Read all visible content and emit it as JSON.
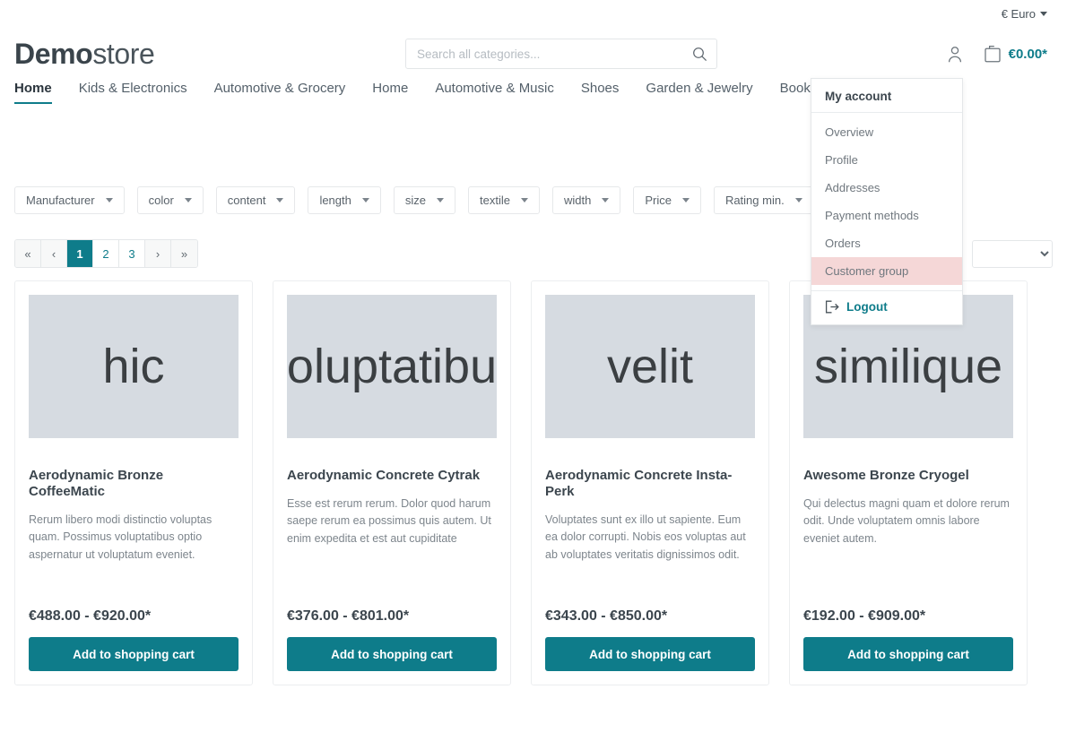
{
  "utility": {
    "currency_label": "€ Euro",
    "caret_icon": "caret-down-icon"
  },
  "header": {
    "logo_bold": "Demo",
    "logo_light": "store",
    "search": {
      "placeholder": "Search all categories...",
      "value": "",
      "icon": "search-icon"
    },
    "account_icon": "user-icon",
    "cart_icon": "shopping-bag-icon",
    "cart_amount": "€0.00*"
  },
  "nav": {
    "items": [
      {
        "label": "Home",
        "active": true
      },
      {
        "label": "Kids & Electronics",
        "active": false
      },
      {
        "label": "Automotive & Grocery",
        "active": false
      },
      {
        "label": "Home",
        "active": false
      },
      {
        "label": "Automotive & Music",
        "active": false
      },
      {
        "label": "Shoes",
        "active": false
      },
      {
        "label": "Garden & Jewelry",
        "active": false
      },
      {
        "label": "Books, Home",
        "active": false
      }
    ]
  },
  "filters": [
    {
      "label": "Manufacturer"
    },
    {
      "label": "color"
    },
    {
      "label": "content"
    },
    {
      "label": "length"
    },
    {
      "label": "size"
    },
    {
      "label": "textile"
    },
    {
      "label": "width"
    },
    {
      "label": "Price"
    },
    {
      "label": "Rating min."
    }
  ],
  "listing": {
    "pagination": [
      {
        "label": "«",
        "type": "arrow",
        "name": "first-page"
      },
      {
        "label": "‹",
        "type": "arrow",
        "name": "prev-page"
      },
      {
        "label": "1",
        "type": "active",
        "name": "page-1"
      },
      {
        "label": "2",
        "type": "page",
        "name": "page-2"
      },
      {
        "label": "3",
        "type": "page",
        "name": "page-3"
      },
      {
        "label": "›",
        "type": "arrow",
        "name": "next-page"
      },
      {
        "label": "»",
        "type": "arrow",
        "name": "last-page"
      }
    ],
    "sorting": {
      "selected": "",
      "options": [
        ""
      ]
    }
  },
  "products": [
    {
      "image_text": "hic",
      "title": "Aerodynamic Bronze CoffeeMatic",
      "description": "Rerum libero modi distinctio voluptas quam. Possimus voluptatibus optio aspernatur ut voluptatum eveniet.",
      "price": "€488.00 - €920.00*",
      "button": "Add to shopping cart"
    },
    {
      "image_text": "voluptatibus",
      "title": "Aerodynamic Concrete Cytrak",
      "description": "Esse est rerum rerum. Dolor quod harum saepe rerum ea possimus quis autem. Ut enim expedita et est aut cupiditate",
      "price": "€376.00 - €801.00*",
      "button": "Add to shopping cart"
    },
    {
      "image_text": "velit",
      "title": "Aerodynamic Concrete Insta-Perk",
      "description": "Voluptates sunt ex illo ut sapiente. Eum ea dolor corrupti. Nobis eos voluptas aut ab voluptates veritatis dignissimos odit.",
      "price": "€343.00 - €850.00*",
      "button": "Add to shopping cart"
    },
    {
      "image_text": "similique",
      "title": "Awesome Bronze Cryogel",
      "description": "Qui delectus magni quam et dolore rerum odit. Unde voluptatem omnis labore eveniet autem.",
      "price": "€192.00 - €909.00*",
      "button": "Add to shopping cart"
    }
  ],
  "account_dropdown": {
    "title": "My account",
    "items": [
      {
        "label": "Overview",
        "highlight": false
      },
      {
        "label": "Profile",
        "highlight": false
      },
      {
        "label": "Addresses",
        "highlight": false
      },
      {
        "label": "Payment methods",
        "highlight": false
      },
      {
        "label": "Orders",
        "highlight": false
      },
      {
        "label": "Customer group",
        "highlight": true
      }
    ],
    "logout_label": "Logout",
    "logout_icon": "logout-icon"
  },
  "colors": {
    "accent": "#0e7c8a",
    "text": "#4a545b",
    "muted": "#7d858c",
    "placeholder_bg": "#d6dbe1",
    "highlight": "#f5d7d7",
    "border": "#e4e7e9"
  }
}
